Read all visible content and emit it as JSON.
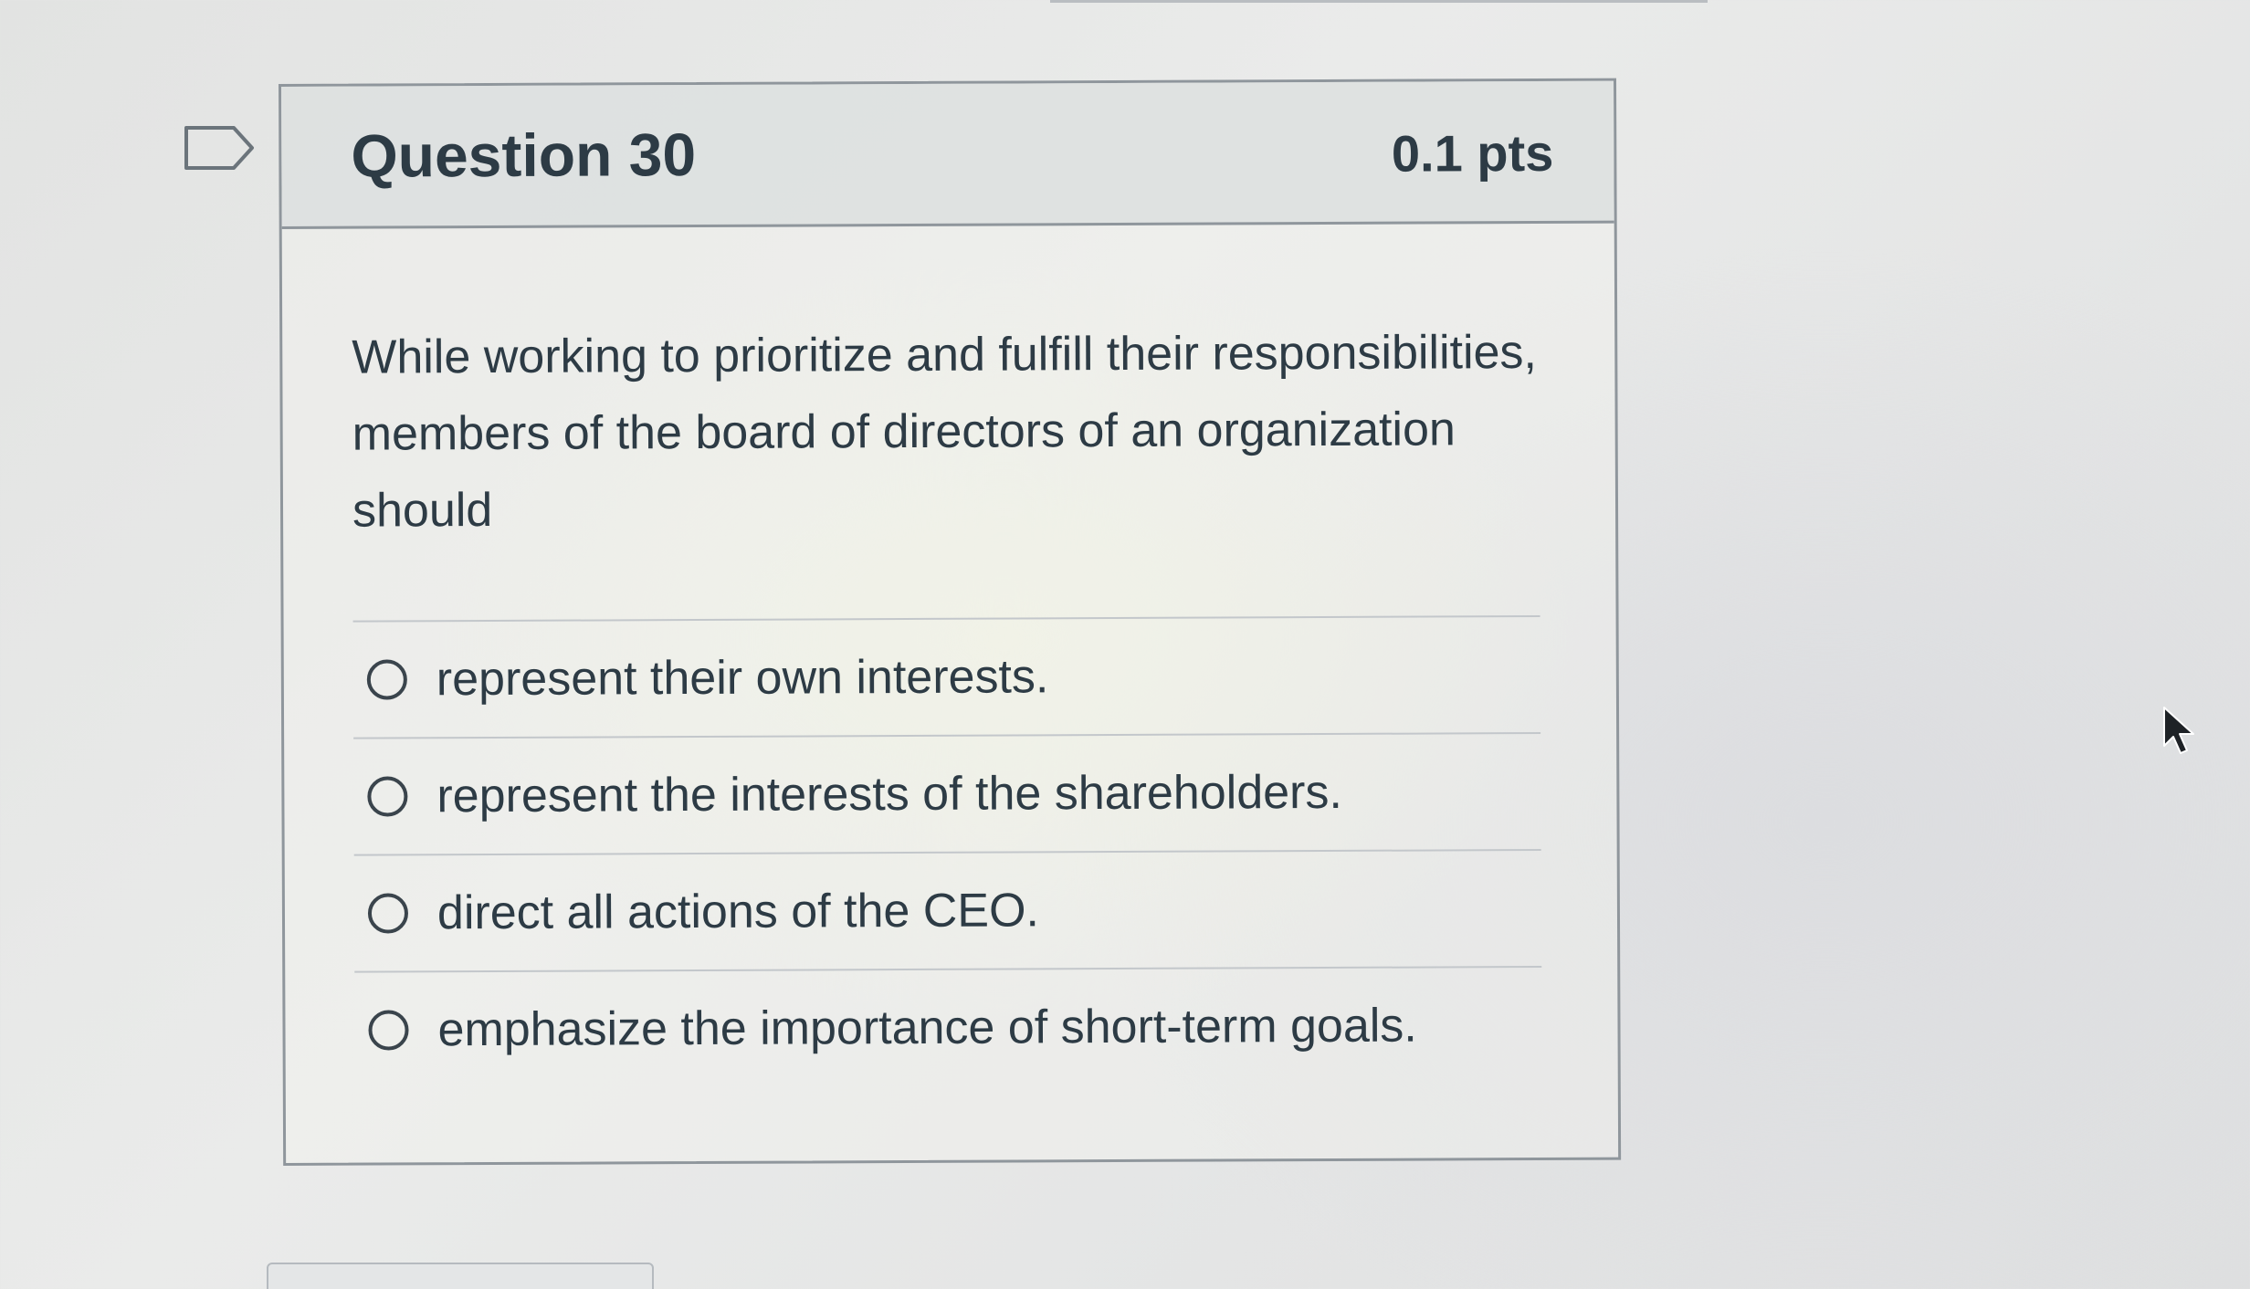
{
  "question": {
    "title": "Question 30",
    "points": "0.1 pts",
    "text": "While working to prioritize and fulfill their responsibilities, members of the board of directors of an organization should",
    "answers": [
      {
        "label": "represent their own interests.",
        "selected": false
      },
      {
        "label": "represent the interests of the shareholders.",
        "selected": false
      },
      {
        "label": "direct all actions of the CEO.",
        "selected": false
      },
      {
        "label": "emphasize the importance of short-term goals.",
        "selected": false
      }
    ]
  },
  "icons": {
    "flag": "flag-question-icon",
    "cursor": "mouse-pointer-icon"
  },
  "colors": {
    "text": "#2d3b45",
    "border": "#8f969c",
    "header_bg": "#dadddE"
  }
}
